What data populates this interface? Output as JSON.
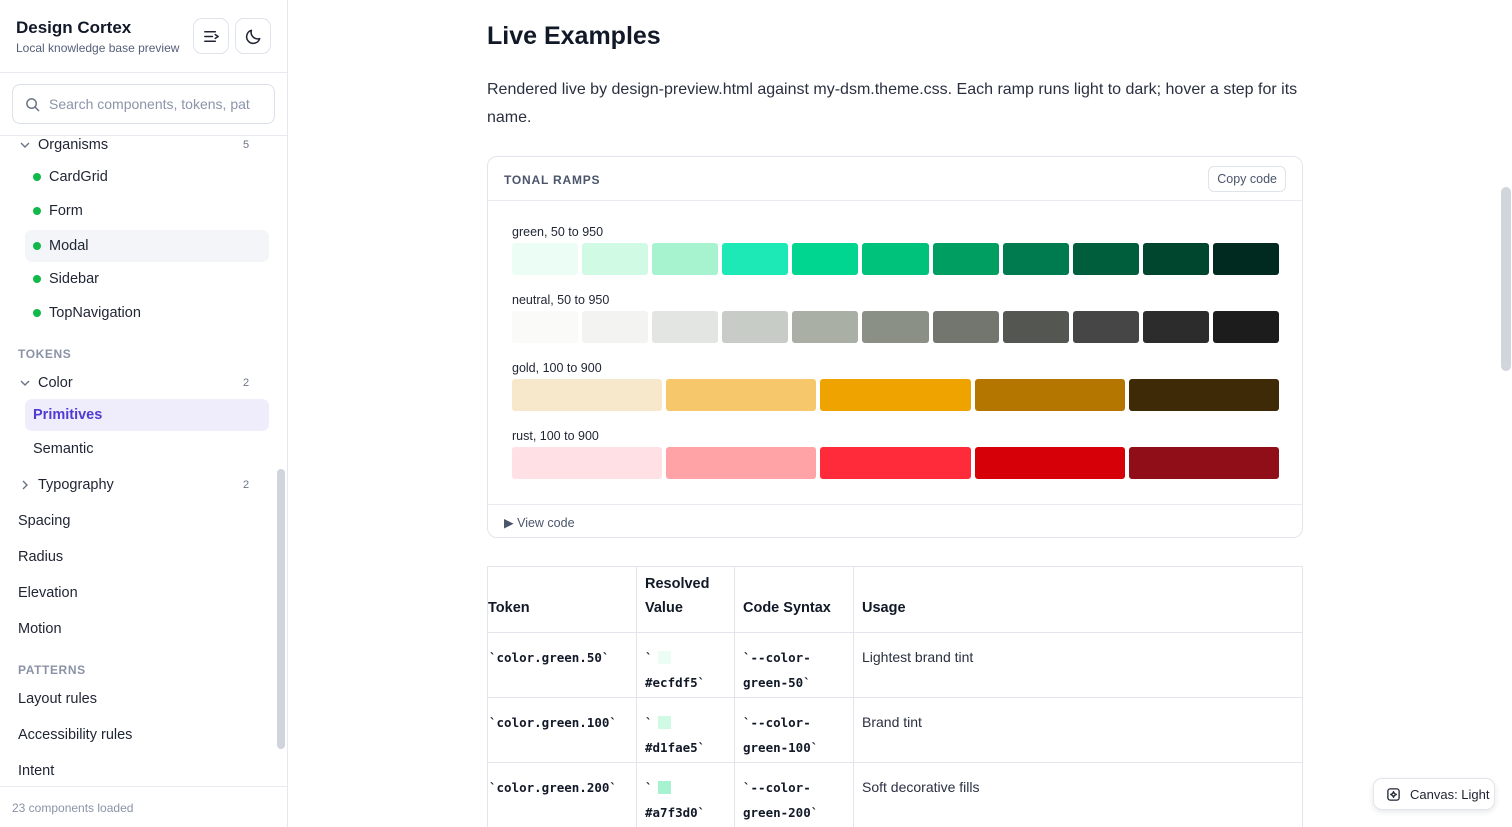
{
  "app": {
    "title": "Design Cortex",
    "subtitle": "Local knowledge base preview"
  },
  "search": {
    "placeholder": "Search components, tokens, pat"
  },
  "sidebar": {
    "organisms": {
      "label": "Organisms",
      "count": "5",
      "items": [
        "CardGrid",
        "Form",
        "Modal",
        "Sidebar",
        "TopNavigation"
      ]
    },
    "tokens_section": "TOKENS",
    "color": {
      "label": "Color",
      "count": "2",
      "items": [
        "Primitives",
        "Semantic"
      ]
    },
    "typography": {
      "label": "Typography",
      "count": "2"
    },
    "token_items": [
      "Spacing",
      "Radius",
      "Elevation",
      "Motion"
    ],
    "patterns_section": "PATTERNS",
    "pattern_items": [
      "Layout rules",
      "Accessibility rules",
      "Intent"
    ],
    "footer": "23 components loaded"
  },
  "main": {
    "title": "Live Examples",
    "intro": "Rendered live by design-preview.html against my-dsm.theme.css. Each ramp runs light to dark; hover a step for its name.",
    "card": {
      "title": "TONAL RAMPS",
      "copy_label": "Copy code",
      "view_code": "▶ View code",
      "ramps": [
        {
          "label": "green, 50 to 950",
          "colors": [
            "#ecfdf5",
            "#d1fae5",
            "#a7f3d0",
            "#1de9b6",
            "#00d68f",
            "#00c27a",
            "#009e60",
            "#007a4f",
            "#005e3d",
            "#00452e",
            "#002a1f"
          ]
        },
        {
          "label": "neutral, 50 to 950",
          "colors": [
            "#fafaf8",
            "#f3f3f1",
            "#e2e5e1",
            "#c8ccc6",
            "#a9afa5",
            "#8a9085",
            "#72766f",
            "#545652",
            "#464646",
            "#2c2c2c",
            "#1b1c1b"
          ]
        },
        {
          "label": "gold, 100 to 900",
          "colors": [
            "#f7e8cc",
            "#f6c76b",
            "#eea300",
            "#b57600",
            "#3e2a06"
          ]
        },
        {
          "label": "rust, 100 to 900",
          "colors": [
            "#ffe0e4",
            "#ffa3a6",
            "#ff2a3a",
            "#d50008",
            "#8f0e18"
          ]
        }
      ]
    },
    "table": {
      "headers": {
        "token": "Token",
        "resolved": "Resolved Value",
        "syntax": "Code Syntax",
        "usage": "Usage"
      },
      "rows": [
        {
          "token": "`color.green.50`",
          "tick": "`",
          "value": "#ecfdf5`",
          "swatch": "#ecfdf5",
          "syntax": "`--color-green-50`",
          "usage": "Lightest brand tint"
        },
        {
          "token": "`color.green.100`",
          "tick": "`",
          "value": "#d1fae5`",
          "swatch": "#d1fae5",
          "syntax": "`--color-green-100`",
          "usage": "Brand tint"
        },
        {
          "token": "`color.green.200`",
          "tick": "`",
          "value": "#a7f3d0`",
          "swatch": "#a7f3d0",
          "syntax": "`--color-green-200`",
          "usage": "Soft decorative fills"
        }
      ]
    }
  },
  "canvas_toggle": {
    "label": "Canvas: Light"
  },
  "colors": {
    "accent": "#4f3bd1",
    "accent_bg": "#efedfc",
    "hover_bg": "#f3f5f9",
    "status_dot": "#12b84a"
  },
  "icons": {
    "collapse": "collapse-sidebar-icon",
    "theme": "moon-icon",
    "search": "search-icon",
    "canvas": "canvas-icon"
  }
}
